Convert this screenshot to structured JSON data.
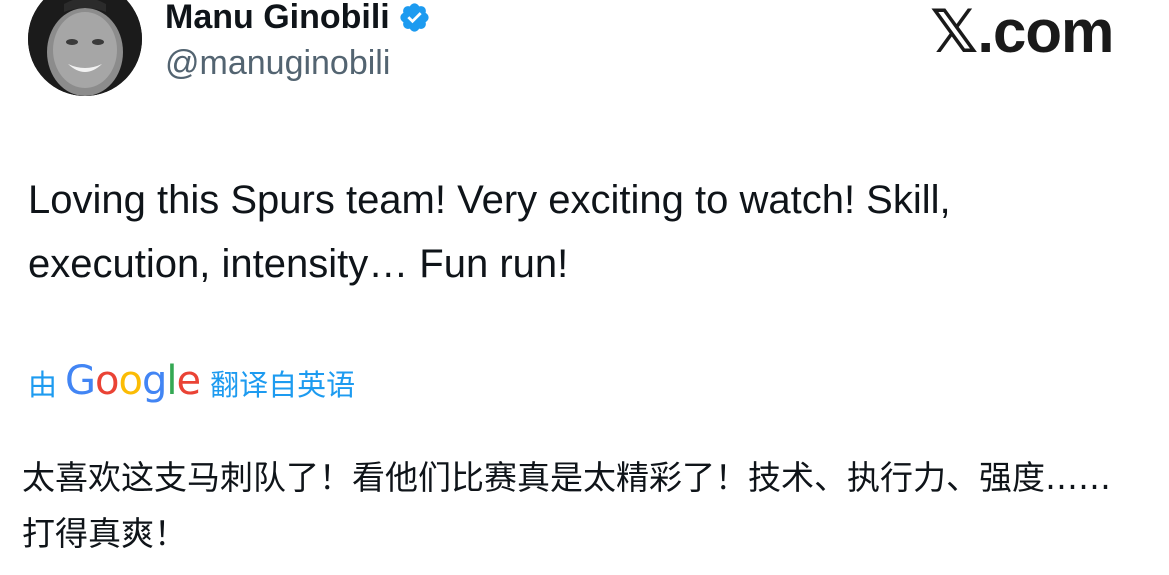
{
  "author": {
    "display_name": "Manu Ginobili",
    "handle": "@manuginobili",
    "verified_icon": "verified-badge-icon",
    "badge_color": "#1d9bf0"
  },
  "brand": {
    "label": "𝕏.com"
  },
  "tweet": {
    "text": "Loving this Spurs team! Very exciting to watch! Skill, execution, intensity… Fun run!"
  },
  "translation": {
    "prefix": "由",
    "provider": "Google",
    "suffix": "翻译自英语",
    "text": "太喜欢这支马刺队了！看他们比赛真是太精彩了！技术、执行力、强度……打得真爽！"
  },
  "colors": {
    "accent": "#1d9bf0",
    "text": "#0f1419",
    "secondary_text": "#536471"
  }
}
